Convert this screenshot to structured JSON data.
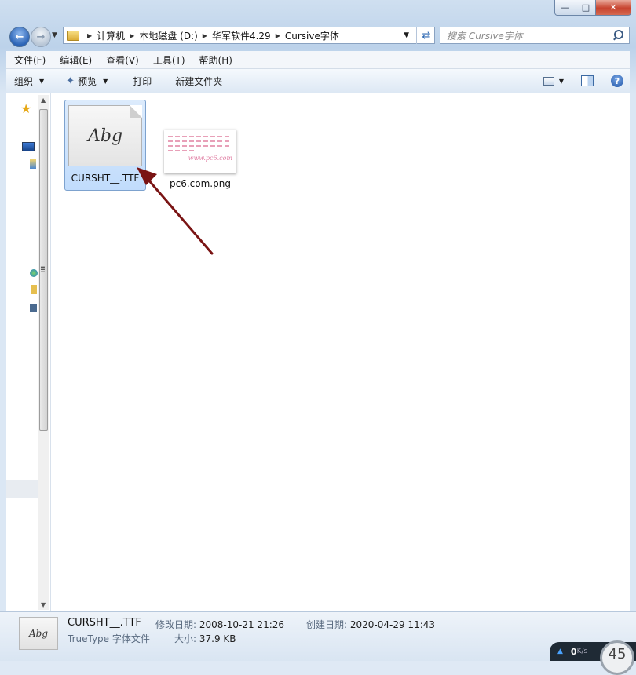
{
  "window": {
    "minimize_glyph": "—",
    "maximize_glyph": "□",
    "close_glyph": "✕"
  },
  "navigation": {
    "back_glyph": "←",
    "forward_glyph": "→",
    "breadcrumbs": [
      "计算机",
      "本地磁盘 (D:)",
      "华军软件4.29",
      "Cursive字体"
    ],
    "refresh_glyph": "⇄",
    "search_placeholder": "搜索 Cursive字体"
  },
  "menu": [
    "文件(F)",
    "编辑(E)",
    "查看(V)",
    "工具(T)",
    "帮助(H)"
  ],
  "commands": {
    "organize": "组织",
    "preview": "预览",
    "print": "打印",
    "new_folder": "新建文件夹",
    "help_glyph": "?"
  },
  "files": [
    {
      "name": "CURSHT__.TTF",
      "glyph": "Abg",
      "selected": true
    },
    {
      "name": "pc6.com.png",
      "preview_text": "www.pc6.com",
      "selected": false
    }
  ],
  "details": {
    "name": "CURSHT__.TTF",
    "type": "TrueType 字体文件",
    "modified_label": "修改日期:",
    "modified_value": "2008-10-21 21:26",
    "size_label": "大小:",
    "size_value": "37.9 KB",
    "created_label": "创建日期:",
    "created_value": "2020-04-29 11:43",
    "thumb_glyph": "Abg"
  },
  "network_widget": {
    "rate": "0",
    "unit": "K/s",
    "gauge": "45"
  },
  "colors": {
    "annotation_arrow": "#7a1414",
    "selection_fill": "#cce3fc",
    "selection_border": "#7da2ce"
  }
}
